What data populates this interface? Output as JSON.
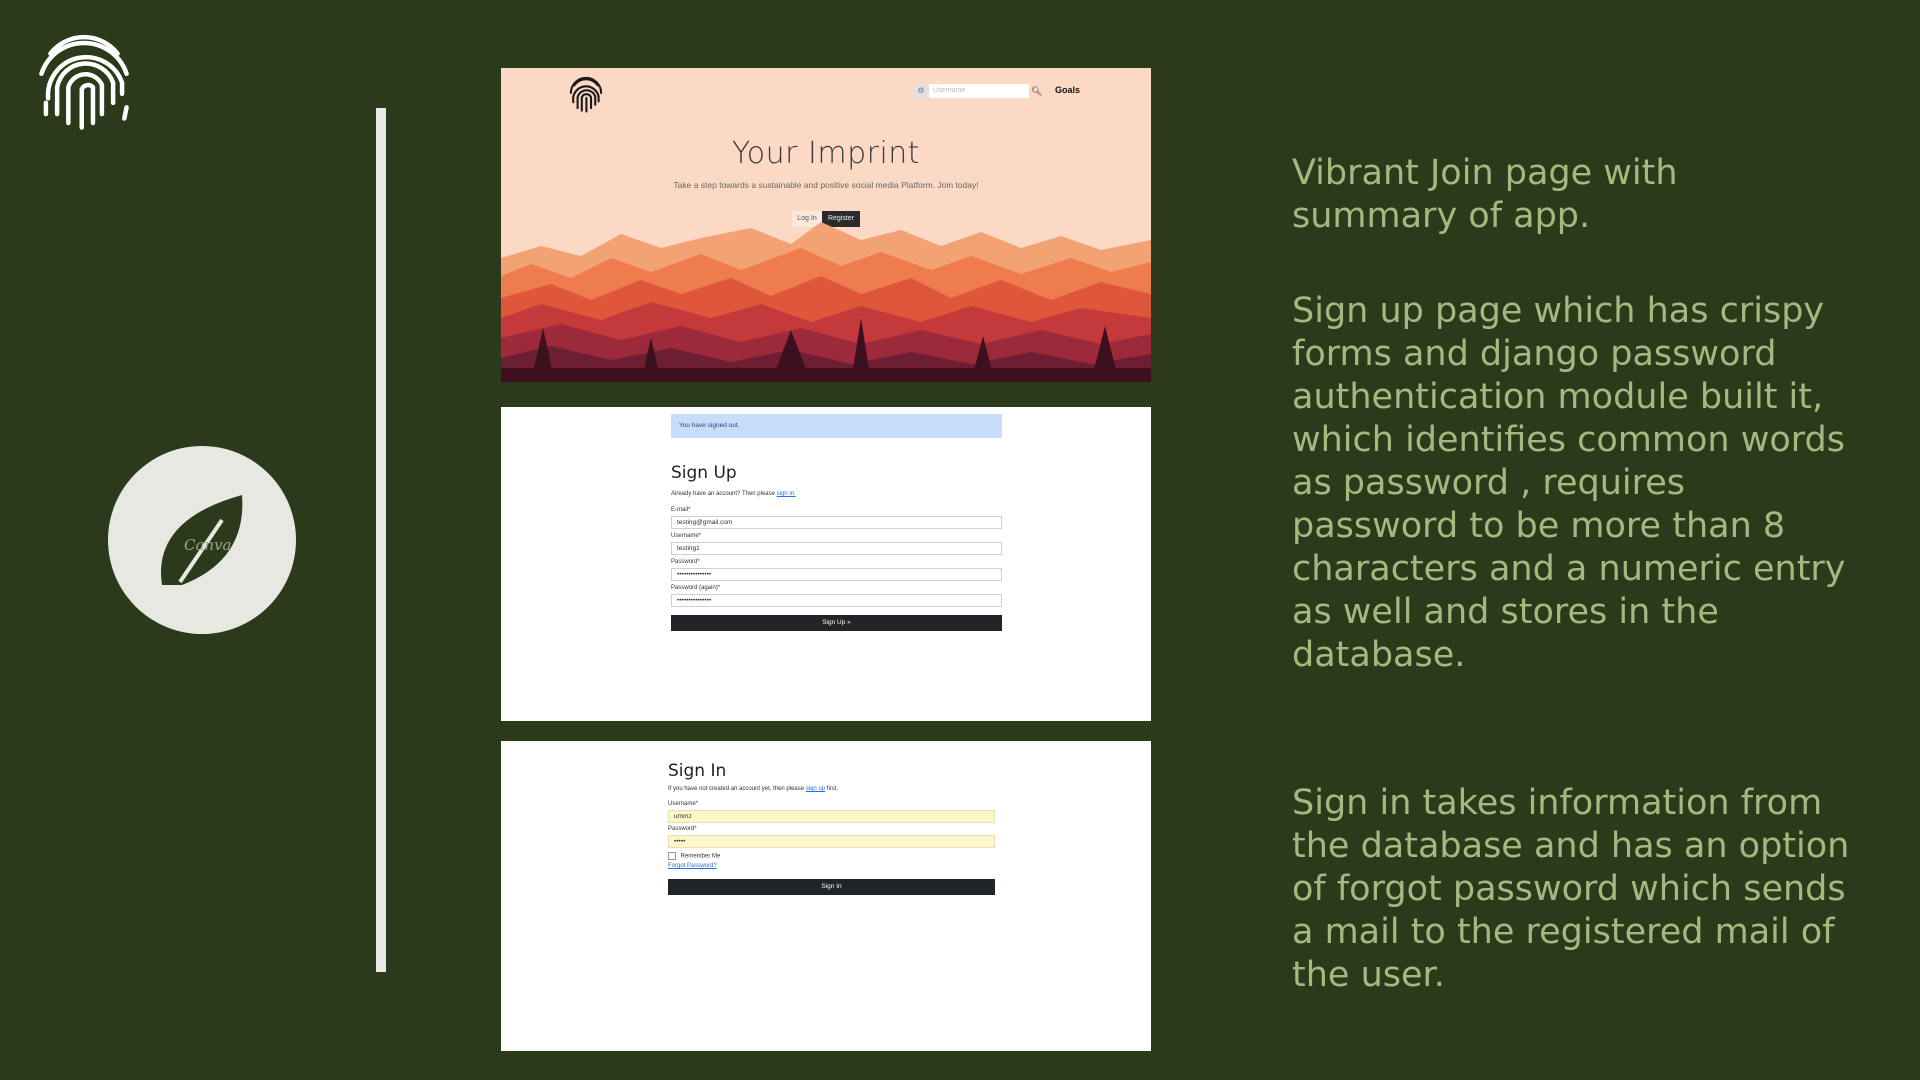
{
  "colors": {
    "background": "#2b3a1b",
    "accent_text": "#a2ba80",
    "divider": "#e8e8e4"
  },
  "icons": {
    "fingerprint": "fingerprint-icon",
    "leaf": "canva-leaf-icon",
    "search": "search-icon",
    "settings": "gear-icon"
  },
  "leaf_logo_text": "Canva",
  "join_page": {
    "search_placeholder": "Username",
    "nav_goals": "Goals",
    "title": "Your Imprint",
    "subtitle": "Take a step towards a sustainable and positive social media Platform. Join today!",
    "login_button": "Log In",
    "register_button": "Register"
  },
  "signup_page": {
    "alert": "You have signed out.",
    "title": "Sign Up",
    "intro": "Already have an account? Then please",
    "intro_link": "sign in.",
    "email_label": "E-mail*",
    "email_value": "testing@gmail.com",
    "username_label": "Username*",
    "username_value": "testing1",
    "password_label": "Password*",
    "password_value": "•••••••••••••••",
    "password_again_label": "Password (again)*",
    "password_again_value": "•••••••••••••••",
    "submit": "Sign Up »"
  },
  "signin_page": {
    "title": "Sign In",
    "intro": "If you have not created an account yet, then please",
    "intro_link": "sign up",
    "intro_end": "first.",
    "username_label": "Username*",
    "username_value": "ummz",
    "password_label": "Password*",
    "password_value": "•••••",
    "remember_me": "Remember Me",
    "forgot": "Forgot Password?",
    "submit": "Sign In"
  },
  "descriptions": {
    "join": "Vibrant Join page with summary of app.",
    "signup": "Sign up page which has crispy forms and django password authentication module built it, which identifies common words as password , requires password to be more than 8 characters and a numeric entry as well and stores in the database.",
    "signin": "Sign in takes information from the database and has an option of forgot password which sends a mail to the registered mail of the user."
  }
}
